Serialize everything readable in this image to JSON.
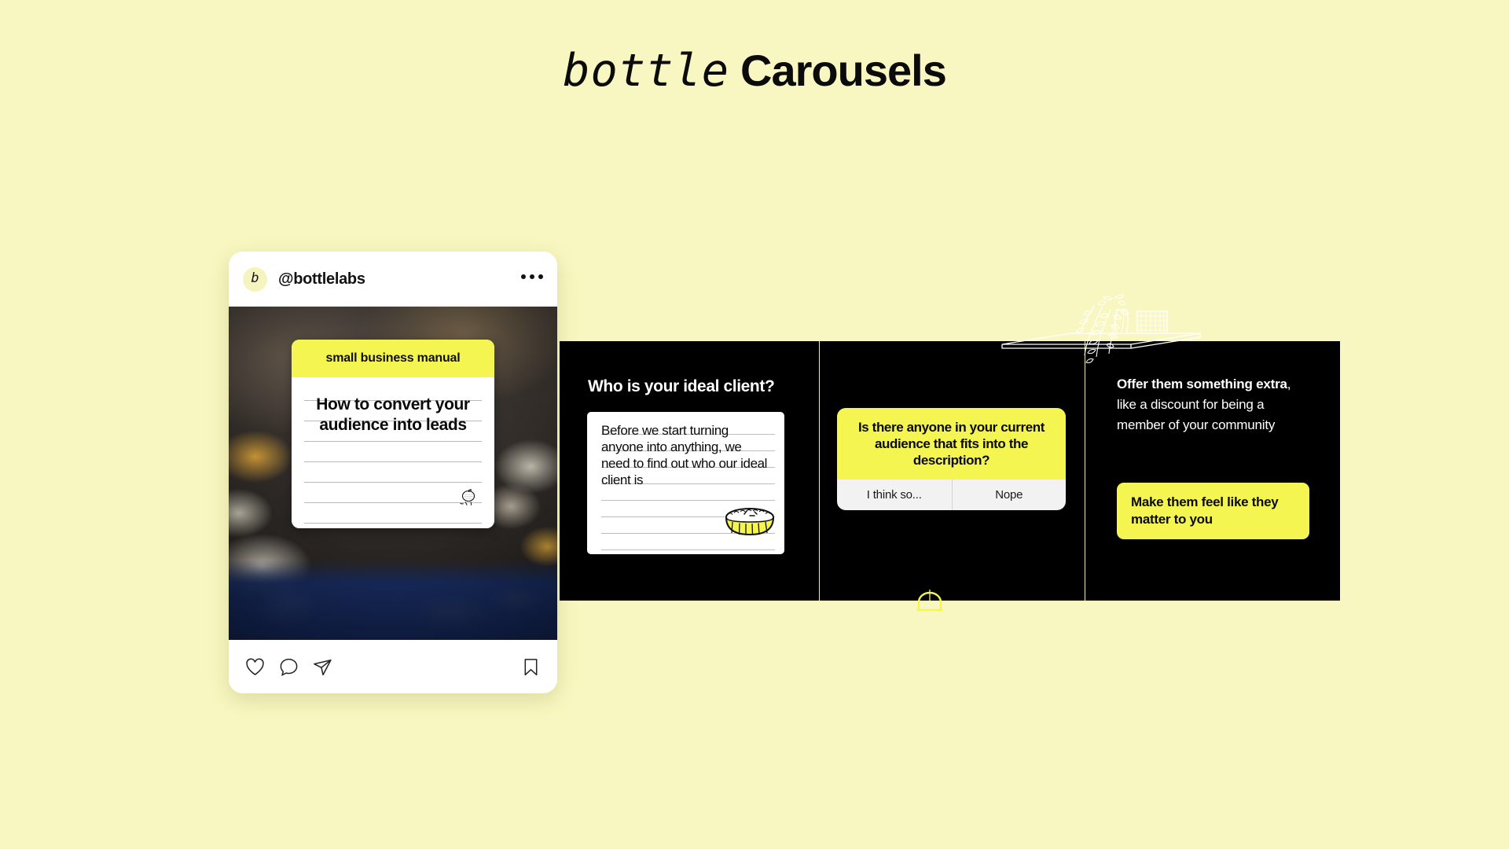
{
  "page": {
    "background_color": "#F8F7C1",
    "accent_yellow": "#F5F551",
    "black": "#000000"
  },
  "title": {
    "script_word": "bottle",
    "bold_word": "Carousels"
  },
  "instagram_post": {
    "handle": "@bottlelabs",
    "avatar_letter": "b",
    "more_icon": "more-options-icon",
    "slide": {
      "banner_label": "small business manual",
      "headline": "How to convert your audience into leads",
      "doodle": "lemon-doodle"
    },
    "actions": {
      "like": "heart-icon",
      "comment": "comment-icon",
      "share": "share-icon",
      "save": "bookmark-icon"
    }
  },
  "carousel": {
    "panels": [
      {
        "id": "panel-1",
        "heading": "Who is your ideal client?",
        "note_text": "Before we start turning anyone into anything, we need to find out who our ideal client is",
        "doodle": "pie-doodle"
      },
      {
        "id": "panel-2",
        "poll": {
          "question_part_1": "Is there anyone in your ",
          "question_part_2": "current audience",
          "question_part_3": " that fits into the description?",
          "options": [
            "I think so...",
            "Nope"
          ]
        },
        "doodle": "arch-doodle"
      },
      {
        "id": "panel-3",
        "illustration": "shelf-plant-line-art",
        "body_bold": "Offer them something extra",
        "body_rest": ", like a discount for being a member of your community",
        "cta_label": "Make them feel like they matter to you"
      }
    ]
  }
}
